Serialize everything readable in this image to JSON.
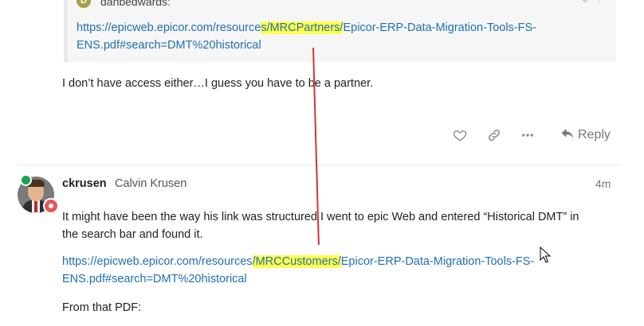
{
  "quote": {
    "avatar_letter": "D",
    "username": "danbedwards:",
    "link_before": "https://epicweb.epicor.com/resource",
    "link_highlight": "s/MRCPartners/",
    "link_after_line1": "Epicor-ERP-Data-Migration-Tools-FS-",
    "link_line2": "ENS.pdf#search=DMT%20historical"
  },
  "post1": {
    "text": "I don’t have access either…I guess you have to be a partner."
  },
  "actions": {
    "like_icon": "heart-icon",
    "link_icon": "link-icon",
    "more_icon": "more-icon",
    "reply_label": "Reply"
  },
  "post2": {
    "username": "ckrusen",
    "fullname": "Calvin Krusen",
    "time": "4m",
    "text_line1": "It might have been the way his link was structured I went to epic Web and entered “Historical DMT” in",
    "text_line2": "the search bar and found it.",
    "link_before": "https://epicweb.epicor.com/resources",
    "link_highlight": "/MRCCustomers/",
    "link_after_line1": "Epicor-ERP-Data-Migration-Tools-FS-",
    "link_line2": "ENS.pdf#search=DMT%20historical",
    "text_after": "From that PDF:"
  },
  "colors": {
    "link": "#1f6fb3",
    "highlight": "#ffff4d",
    "annotation_line": "#d83232",
    "online": "#1ca551"
  }
}
